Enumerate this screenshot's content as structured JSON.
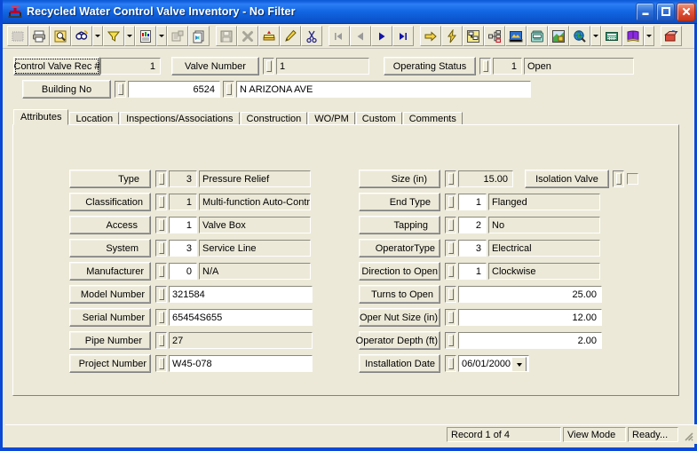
{
  "window": {
    "title": "Recycled Water Control Valve Inventory - No Filter",
    "title_icon": "valve-icon",
    "minimize_label": "Minimize",
    "maximize_label": "Maximize",
    "close_label": "Close",
    "accent_color": "#1266e2",
    "face_color": "#ece9d8"
  },
  "toolbar": {
    "items": [
      {
        "name": "select-tool-icon",
        "label": "Select"
      },
      {
        "name": "print-icon",
        "label": "Print"
      },
      {
        "name": "print-preview-icon",
        "label": "Print Preview"
      },
      {
        "name": "find-icon",
        "label": "Find"
      },
      {
        "name": "find-dropdown",
        "label": "Find options"
      },
      {
        "name": "filter-icon",
        "label": "Filter"
      },
      {
        "name": "filter-dropdown",
        "label": "Filter options"
      },
      {
        "name": "report-icon",
        "label": "Report"
      },
      {
        "name": "report-dropdown",
        "label": "Report options"
      },
      {
        "name": "copy-record-icon",
        "label": "Copy Record"
      },
      {
        "name": "duplicate-icon",
        "label": "Duplicate"
      },
      {
        "name": "save-icon",
        "label": "Save"
      },
      {
        "name": "delete-icon",
        "label": "Delete"
      },
      {
        "name": "new-record-icon",
        "label": "New Record"
      },
      {
        "name": "edit-icon",
        "label": "Edit"
      },
      {
        "name": "cut-icon",
        "label": "Cut"
      },
      {
        "name": "first-record-icon",
        "label": "First Record"
      },
      {
        "name": "previous-record-icon",
        "label": "Previous Record"
      },
      {
        "name": "next-record-icon",
        "label": "Next Record"
      },
      {
        "name": "last-record-icon",
        "label": "Last Record"
      },
      {
        "name": "goto-icon",
        "label": "Go To"
      },
      {
        "name": "quick-action-icon",
        "label": "Quick Action"
      },
      {
        "name": "workflow-icon",
        "label": "Workflow"
      },
      {
        "name": "hierarchy-icon",
        "label": "Hierarchy"
      },
      {
        "name": "document-image-icon",
        "label": "Document Image"
      },
      {
        "name": "telephone-icon",
        "label": "Telephone"
      },
      {
        "name": "map-icon",
        "label": "Map"
      },
      {
        "name": "globe-search-icon",
        "label": "GIS Search"
      },
      {
        "name": "globe-search-dropdown",
        "label": "GIS Search options"
      },
      {
        "name": "calculator-icon",
        "label": "Calculator"
      },
      {
        "name": "help-book-icon",
        "label": "Help"
      },
      {
        "name": "help-dropdown",
        "label": "Help options"
      },
      {
        "name": "exit-icon",
        "label": "Exit"
      }
    ]
  },
  "header_fields": {
    "record_id": {
      "label": "Control Valve Rec #",
      "value": "1",
      "editable": false,
      "focused": true
    },
    "valve_number": {
      "label": "Valve Number",
      "value": "1",
      "editable": false
    },
    "operating_status": {
      "label": "Operating Status",
      "code": "1",
      "value": "Open",
      "editable": false
    },
    "building_no": {
      "label": "Building No",
      "code": "6524",
      "value": "N ARIZONA AVE",
      "editable": true
    }
  },
  "tabs": {
    "active_index": 0,
    "items": [
      {
        "label": "Attributes"
      },
      {
        "label": "Location"
      },
      {
        "label": "Inspections/Associations"
      },
      {
        "label": "Construction"
      },
      {
        "label": "WO/PM"
      },
      {
        "label": "Custom"
      },
      {
        "label": "Comments"
      }
    ]
  },
  "attributes": {
    "left_column": [
      {
        "label": "Type",
        "code": "3",
        "code_editable": false,
        "value": "Pressure Relief",
        "value_editable": false
      },
      {
        "label": "Classification",
        "code": "1",
        "code_editable": false,
        "value": "Multi-function Auto-Contr",
        "value_editable": false
      },
      {
        "label": "Access",
        "code": "1",
        "code_editable": true,
        "value": "Valve Box",
        "value_editable": false
      },
      {
        "label": "System",
        "code": "3",
        "code_editable": true,
        "value": "Service Line",
        "value_editable": false
      },
      {
        "label": "Manufacturer",
        "code": "0",
        "code_editable": true,
        "value": "N/A",
        "value_editable": false
      },
      {
        "label": "Model Number",
        "code": null,
        "value": "321584",
        "value_editable": true
      },
      {
        "label": "Serial Number",
        "code": null,
        "value": "65454S655",
        "value_editable": true
      },
      {
        "label": "Pipe Number",
        "code": null,
        "value": "27",
        "value_editable": false
      },
      {
        "label": "Project Number",
        "code": null,
        "value": "W45-078",
        "value_editable": true
      }
    ],
    "right_column": [
      {
        "label": "Size (in)",
        "code": null,
        "value": "15.00",
        "value_editable": false,
        "numeric": true
      },
      {
        "label": "End Type",
        "code": "1",
        "code_editable": true,
        "value": "Flanged",
        "value_editable": false
      },
      {
        "label": "Tapping",
        "code": "2",
        "code_editable": true,
        "value": "No",
        "value_editable": false
      },
      {
        "label": "OperatorType",
        "code": "3",
        "code_editable": true,
        "value": "Electrical",
        "value_editable": false
      },
      {
        "label": "Direction to Open",
        "code": "1",
        "code_editable": true,
        "value": "Clockwise",
        "value_editable": false
      },
      {
        "label": "Turns to Open",
        "code": null,
        "value": "25.00",
        "value_editable": true,
        "numeric": true
      },
      {
        "label": "Oper Nut Size (in)",
        "code": null,
        "value": "12.00",
        "value_editable": true,
        "numeric": true
      },
      {
        "label": "Operator Depth (ft)",
        "code": null,
        "value": "2.00",
        "value_editable": true,
        "numeric": true
      },
      {
        "label": "Installation Date",
        "code": null,
        "value": "06/01/2000",
        "value_editable": true,
        "is_date": true
      }
    ],
    "isolation_valve": {
      "label": "Isolation Valve",
      "checked": false
    }
  },
  "statusbar": {
    "record_counter": "Record 1 of 4",
    "mode": "View Mode",
    "state": "Ready..."
  }
}
